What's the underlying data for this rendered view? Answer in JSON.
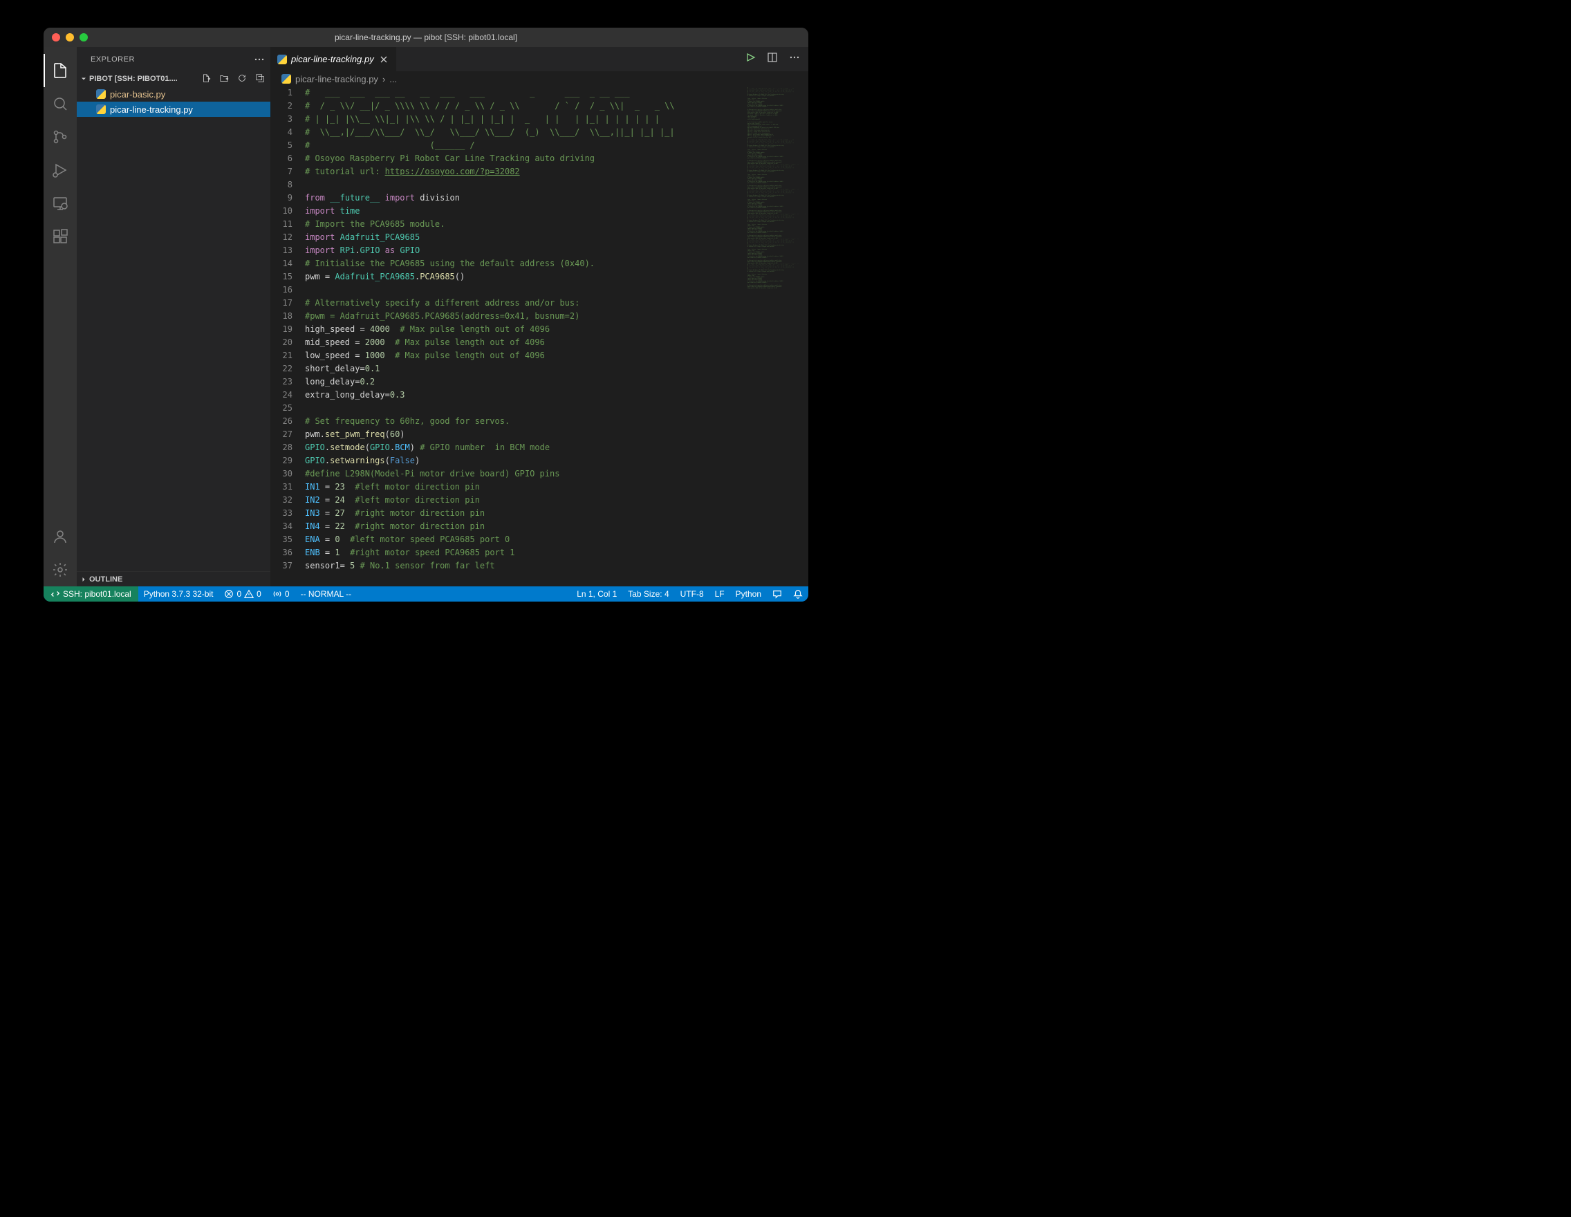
{
  "window": {
    "title": "picar-line-tracking.py — pibot [SSH: pibot01.local]"
  },
  "sidebar": {
    "header": "EXPLORER",
    "folder": "PIBOT [SSH: PIBOT01....",
    "files": [
      {
        "name": "picar-basic.py",
        "modified": true,
        "selected": false
      },
      {
        "name": "picar-line-tracking.py",
        "modified": false,
        "selected": true
      }
    ],
    "outline": "OUTLINE"
  },
  "tabs": {
    "active": "picar-line-tracking.py"
  },
  "breadcrumb": {
    "file": "picar-line-tracking.py",
    "sep": "›",
    "more": "..."
  },
  "code_lines": [
    [
      [
        "c-comment",
        "#   ___  ___  ___ __   __  ___   ___         _      ___  _ __ ___"
      ]
    ],
    [
      [
        "c-comment",
        "#  / _ \\\\/ __|/ _ \\\\\\\\ \\\\ / / / _ \\\\ / _ \\\\       / ` /  / _ \\\\|  _   _ \\\\"
      ]
    ],
    [
      [
        "c-comment",
        "# | |_| |\\\\__ \\\\|_| |\\\\ \\\\ / | |_| | |_| |  _   | |   | |_| | | | | | |"
      ]
    ],
    [
      [
        "c-comment",
        "#  \\\\__,|/___/\\\\___/  \\\\_/   \\\\___/ \\\\___/  (_)  \\\\___/  \\\\__,||_| |_| |_|"
      ]
    ],
    [
      [
        "c-comment",
        "#                        (______ /"
      ]
    ],
    [
      [
        "c-comment",
        "# Osoyoo Raspberry Pi Robot Car Line Tracking auto driving"
      ]
    ],
    [
      [
        "c-comment",
        "# tutorial url: "
      ],
      [
        "c-url",
        "https://osoyoo.com/?p=32082"
      ]
    ],
    [],
    [
      [
        "c-keyword",
        "from"
      ],
      [
        "",
        " "
      ],
      [
        "c-module",
        "__future__"
      ],
      [
        "",
        " "
      ],
      [
        "c-keyword",
        "import"
      ],
      [
        "",
        " division"
      ]
    ],
    [
      [
        "c-keyword",
        "import"
      ],
      [
        "",
        " "
      ],
      [
        "c-module",
        "time"
      ]
    ],
    [
      [
        "c-comment",
        "# Import the PCA9685 module."
      ]
    ],
    [
      [
        "c-keyword",
        "import"
      ],
      [
        "",
        " "
      ],
      [
        "c-module",
        "Adafruit_PCA9685"
      ]
    ],
    [
      [
        "c-keyword",
        "import"
      ],
      [
        "",
        " "
      ],
      [
        "c-module",
        "RPi"
      ],
      [
        "",
        "."
      ],
      [
        "c-module",
        "GPIO"
      ],
      [
        "",
        " "
      ],
      [
        "c-keyword",
        "as"
      ],
      [
        "",
        " "
      ],
      [
        "c-module",
        "GPIO"
      ]
    ],
    [
      [
        "c-comment",
        "# Initialise the PCA9685 using the default address (0x40)."
      ]
    ],
    [
      [
        "",
        "pwm "
      ],
      [
        "",
        "="
      ],
      [
        "",
        " "
      ],
      [
        "c-module",
        "Adafruit_PCA9685"
      ],
      [
        "",
        "."
      ],
      [
        "c-func",
        "PCA9685"
      ],
      [
        "",
        "()"
      ]
    ],
    [],
    [
      [
        "c-comment",
        "# Alternatively specify a different address and/or bus:"
      ]
    ],
    [
      [
        "c-comment",
        "#pwm = Adafruit_PCA9685.PCA9685(address=0x41, busnum=2)"
      ]
    ],
    [
      [
        "",
        "high_speed "
      ],
      [
        "",
        "="
      ],
      [
        "",
        " "
      ],
      [
        "c-num",
        "4000"
      ],
      [
        "",
        "  "
      ],
      [
        "c-comment",
        "# Max pulse length out of 4096"
      ]
    ],
    [
      [
        "",
        "mid_speed "
      ],
      [
        "",
        "="
      ],
      [
        "",
        " "
      ],
      [
        "c-num",
        "2000"
      ],
      [
        "",
        "  "
      ],
      [
        "c-comment",
        "# Max pulse length out of 4096"
      ]
    ],
    [
      [
        "",
        "low_speed "
      ],
      [
        "",
        "="
      ],
      [
        "",
        " "
      ],
      [
        "c-num",
        "1000"
      ],
      [
        "",
        "  "
      ],
      [
        "c-comment",
        "# Max pulse length out of 4096"
      ]
    ],
    [
      [
        "",
        "short_delay"
      ],
      [
        "",
        "="
      ],
      [
        "c-num",
        "0.1"
      ]
    ],
    [
      [
        "",
        "long_delay"
      ],
      [
        "",
        "="
      ],
      [
        "c-num",
        "0.2"
      ]
    ],
    [
      [
        "",
        "extra_long_delay"
      ],
      [
        "",
        "="
      ],
      [
        "c-num",
        "0.3"
      ]
    ],
    [],
    [
      [
        "c-comment",
        "# Set frequency to 60hz, good for servos."
      ]
    ],
    [
      [
        "",
        "pwm."
      ],
      [
        "c-func",
        "set_pwm_freq"
      ],
      [
        "",
        "("
      ],
      [
        "c-num",
        "60"
      ],
      [
        "",
        ")"
      ]
    ],
    [
      [
        "c-module",
        "GPIO"
      ],
      [
        "",
        "."
      ],
      [
        "c-func",
        "setmode"
      ],
      [
        "",
        "("
      ],
      [
        "c-module",
        "GPIO"
      ],
      [
        "",
        "."
      ],
      [
        "c-const",
        "BCM"
      ],
      [
        "",
        ") "
      ],
      [
        "c-comment",
        "# GPIO number  in BCM mode"
      ]
    ],
    [
      [
        "c-module",
        "GPIO"
      ],
      [
        "",
        "."
      ],
      [
        "c-func",
        "setwarnings"
      ],
      [
        "",
        "("
      ],
      [
        "c-keyword2",
        "False"
      ],
      [
        "",
        ")"
      ]
    ],
    [
      [
        "c-comment",
        "#define L298N(Model-Pi motor drive board) GPIO pins"
      ]
    ],
    [
      [
        "c-const",
        "IN1"
      ],
      [
        "",
        " "
      ],
      [
        "",
        "="
      ],
      [
        "",
        " "
      ],
      [
        "c-num",
        "23"
      ],
      [
        "",
        "  "
      ],
      [
        "c-comment",
        "#left motor direction pin"
      ]
    ],
    [
      [
        "c-const",
        "IN2"
      ],
      [
        "",
        " "
      ],
      [
        "",
        "="
      ],
      [
        "",
        " "
      ],
      [
        "c-num",
        "24"
      ],
      [
        "",
        "  "
      ],
      [
        "c-comment",
        "#left motor direction pin"
      ]
    ],
    [
      [
        "c-const",
        "IN3"
      ],
      [
        "",
        " "
      ],
      [
        "",
        "="
      ],
      [
        "",
        " "
      ],
      [
        "c-num",
        "27"
      ],
      [
        "",
        "  "
      ],
      [
        "c-comment",
        "#right motor direction pin"
      ]
    ],
    [
      [
        "c-const",
        "IN4"
      ],
      [
        "",
        " "
      ],
      [
        "",
        "="
      ],
      [
        "",
        " "
      ],
      [
        "c-num",
        "22"
      ],
      [
        "",
        "  "
      ],
      [
        "c-comment",
        "#right motor direction pin"
      ]
    ],
    [
      [
        "c-const",
        "ENA"
      ],
      [
        "",
        " "
      ],
      [
        "",
        "="
      ],
      [
        "",
        " "
      ],
      [
        "c-num",
        "0"
      ],
      [
        "",
        "  "
      ],
      [
        "c-comment",
        "#left motor speed PCA9685 port 0"
      ]
    ],
    [
      [
        "c-const",
        "ENB"
      ],
      [
        "",
        " "
      ],
      [
        "",
        "="
      ],
      [
        "",
        " "
      ],
      [
        "c-num",
        "1"
      ],
      [
        "",
        "  "
      ],
      [
        "c-comment",
        "#right motor speed PCA9685 port 1"
      ]
    ],
    [
      [
        "",
        "sensor1"
      ],
      [
        "",
        "="
      ],
      [
        "",
        " "
      ],
      [
        "c-num",
        "5"
      ],
      [
        "",
        " "
      ],
      [
        "c-comment",
        "# No.1 sensor from far left"
      ]
    ]
  ],
  "statusbar": {
    "remote": "SSH: pibot01.local",
    "python": "Python 3.7.3 32-bit",
    "errors": "0",
    "warnings": "0",
    "radio": "0",
    "mode": "-- NORMAL --",
    "position": "Ln 1, Col 1",
    "tabsize": "Tab Size: 4",
    "encoding": "UTF-8",
    "eol": "LF",
    "language": "Python"
  }
}
